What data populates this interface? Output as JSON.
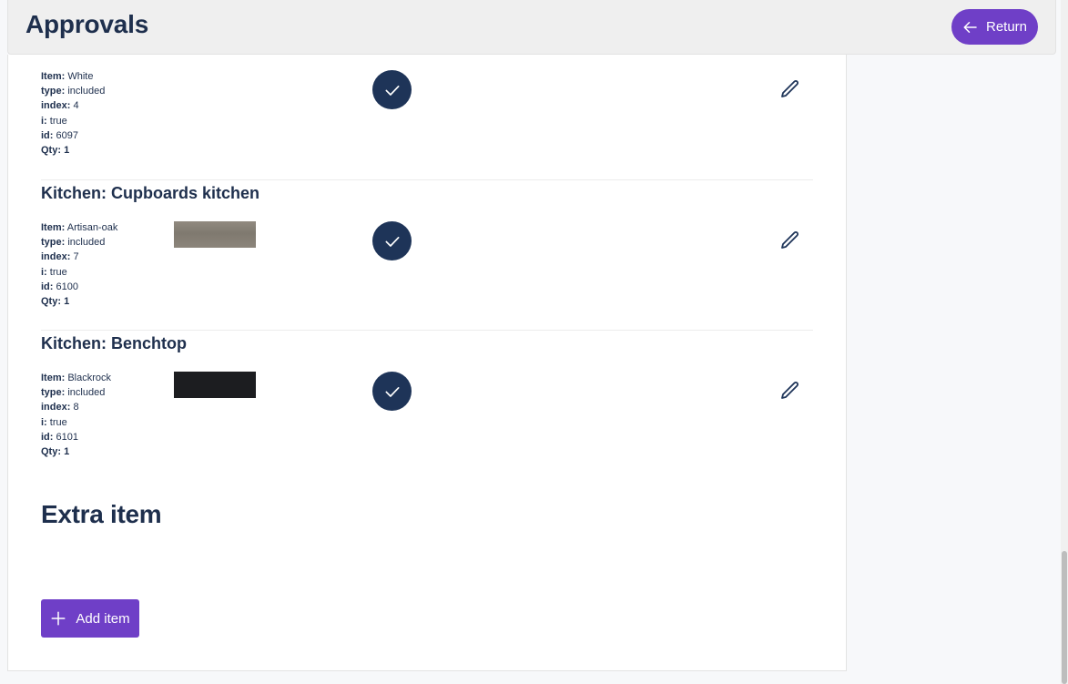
{
  "header": {
    "title": "Approvals",
    "return_label": "Return"
  },
  "sections": [
    {
      "title": "",
      "item": {
        "labels": {
          "item": "Item:",
          "type": "type:",
          "index": "index:",
          "i": "i:",
          "id": "id:",
          "qty": "Qty:"
        },
        "item_value": "White",
        "type_value": "included",
        "index_value": "4",
        "i_value": "true",
        "id_value": "6097",
        "qty_value": "1",
        "swatch_color": ""
      }
    },
    {
      "title": "Kitchen: Cupboards kitchen",
      "item": {
        "labels": {
          "item": "Item:",
          "type": "type:",
          "index": "index:",
          "i": "i:",
          "id": "id:",
          "qty": "Qty:"
        },
        "item_value": "Artisan-oak",
        "type_value": "included",
        "index_value": "7",
        "i_value": "true",
        "id_value": "6100",
        "qty_value": "1",
        "swatch_color": "#8a8378"
      }
    },
    {
      "title": "Kitchen: Benchtop",
      "item": {
        "labels": {
          "item": "Item:",
          "type": "type:",
          "index": "index:",
          "i": "i:",
          "id": "id:",
          "qty": "Qty:"
        },
        "item_value": "Blackrock",
        "type_value": "included",
        "index_value": "8",
        "i_value": "true",
        "id_value": "6101",
        "qty_value": "1",
        "swatch_color": "#1c1d20"
      }
    }
  ],
  "extra": {
    "title": "Extra item",
    "add_label": "Add item"
  },
  "colors": {
    "accent": "#6f3fc7",
    "navy": "#1e3458",
    "text": "#1e2f4d"
  },
  "icons": {
    "return": "arrow-left-icon",
    "approve": "check-icon",
    "edit": "pencil-icon",
    "add": "plus-icon"
  }
}
